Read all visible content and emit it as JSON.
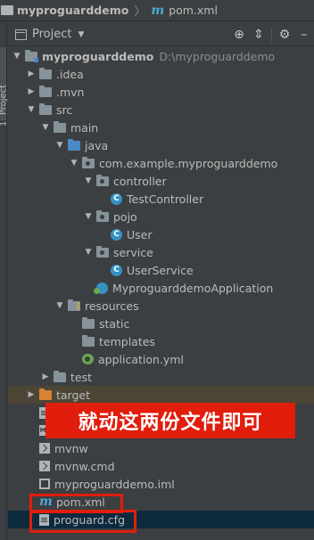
{
  "breadcrumb": {
    "project": "myproguarddemo",
    "file": "pom.xml"
  },
  "side_tab": {
    "label": "1: Project"
  },
  "toolbar": {
    "title": "Project",
    "icons": [
      "crosshair-icon",
      "collapse-icon",
      "gear-icon",
      "hide-icon"
    ]
  },
  "tree": [
    {
      "name": "myproguarddemo",
      "extra": "D:\\myproguarddemo",
      "icon": "module-folder-icon",
      "expanded": true,
      "depth": 0
    },
    {
      "name": ".idea",
      "icon": "folder-icon",
      "expanded": false,
      "depth": 1
    },
    {
      "name": ".mvn",
      "icon": "folder-icon",
      "expanded": false,
      "depth": 1
    },
    {
      "name": "src",
      "icon": "folder-icon",
      "expanded": true,
      "depth": 1
    },
    {
      "name": "main",
      "icon": "folder-icon",
      "expanded": true,
      "depth": 2
    },
    {
      "name": "java",
      "icon": "source-folder-icon",
      "expanded": true,
      "depth": 3
    },
    {
      "name": "com.example.myproguarddemo",
      "icon": "package-icon",
      "expanded": true,
      "depth": 4
    },
    {
      "name": "controller",
      "icon": "package-icon",
      "expanded": true,
      "depth": 5
    },
    {
      "name": "TestController",
      "icon": "class-icon",
      "depth": 6
    },
    {
      "name": "pojo",
      "icon": "package-icon",
      "expanded": true,
      "depth": 5
    },
    {
      "name": "User",
      "icon": "class-icon",
      "depth": 6
    },
    {
      "name": "service",
      "icon": "package-icon",
      "expanded": true,
      "depth": 5
    },
    {
      "name": "UserService",
      "icon": "class-icon",
      "depth": 6
    },
    {
      "name": "MyproguarddemoApplication",
      "icon": "spring-boot-icon",
      "depth": 5
    },
    {
      "name": "resources",
      "icon": "resources-folder-icon",
      "expanded": true,
      "depth": 3
    },
    {
      "name": "static",
      "icon": "folder-icon",
      "depth": 4
    },
    {
      "name": "templates",
      "icon": "folder-icon",
      "depth": 4
    },
    {
      "name": "application.yml",
      "icon": "yaml-spring-icon",
      "depth": 4
    },
    {
      "name": "test",
      "icon": "folder-icon",
      "expanded": false,
      "depth": 2
    },
    {
      "name": "target",
      "icon": "excluded-folder-icon",
      "expanded": false,
      "depth": 1
    },
    {
      "name": "",
      "icon": "file-icon",
      "depth": 1
    },
    {
      "name": "",
      "icon": "markdown-icon",
      "depth": 1
    },
    {
      "name": "mvnw",
      "icon": "terminal-file-icon",
      "depth": 1
    },
    {
      "name": "mvnw.cmd",
      "icon": "terminal-file-icon",
      "depth": 1
    },
    {
      "name": "myproguarddemo.iml",
      "icon": "iml-file-icon",
      "depth": 1
    },
    {
      "name": "pom.xml",
      "icon": "maven-icon",
      "depth": 1
    },
    {
      "name": "proguard.cfg",
      "icon": "config-file-icon",
      "depth": 1
    }
  ],
  "annotation": {
    "text": "就动这两份文件即可"
  },
  "colors": {
    "background": "#3c3f41",
    "text": "#bbbbbb",
    "annotation_red": "#e11d0c",
    "selected_row": "#0d293e",
    "excluded_row": "#4d4536"
  }
}
